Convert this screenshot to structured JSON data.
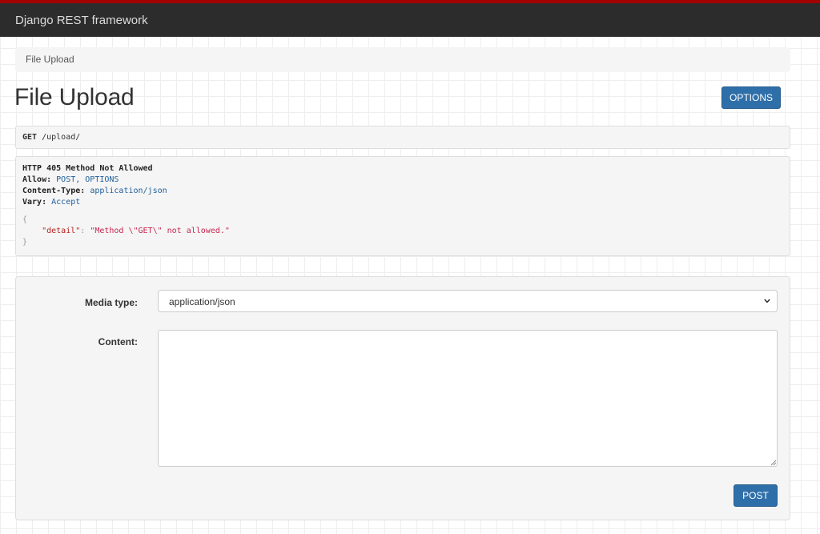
{
  "app": {
    "brand": "Django REST framework"
  },
  "breadcrumb": {
    "item": "File Upload"
  },
  "page": {
    "title": "File Upload",
    "options_label": "OPTIONS"
  },
  "request": {
    "method": "GET",
    "path": "/upload/"
  },
  "response": {
    "status_line": "HTTP 405 Method Not Allowed",
    "headers": [
      {
        "name": "Allow:",
        "value": "POST, OPTIONS"
      },
      {
        "name": "Content-Type:",
        "value": "application/json"
      },
      {
        "name": "Vary:",
        "value": "Accept"
      }
    ],
    "body": {
      "open": "{",
      "key": "\"detail\"",
      "colon": ": ",
      "value": "\"Method \\\"GET\\\" not allowed.\"",
      "close": "}"
    }
  },
  "form": {
    "media_type_label": "Media type:",
    "media_type_value": "application/json",
    "content_label": "Content:",
    "content_value": "",
    "post_label": "POST"
  },
  "colors": {
    "accent": "#2f6fa9",
    "navbar": "#2c2c2c",
    "navbar_top_border": "#a30000"
  },
  "icons": {
    "select_chevron": "chevron-down-icon",
    "textarea_resize": "resize-grip-icon"
  }
}
